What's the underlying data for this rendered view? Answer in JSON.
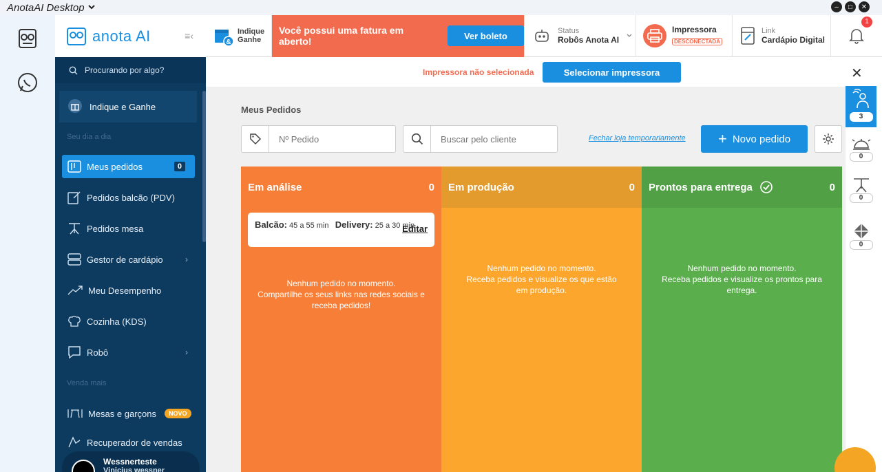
{
  "window": {
    "title": "AnotaAI Desktop"
  },
  "sidebar": {
    "logo": "anota AI",
    "search_placeholder": "Procurando por algo?",
    "invite": "Indique e Ganhe",
    "section_day": "Seu dia a dia",
    "section_sell": "Venda mais",
    "items": [
      {
        "label": "Meus pedidos",
        "count": "0"
      },
      {
        "label": "Pedidos balcão (PDV)"
      },
      {
        "label": "Pedidos mesa"
      },
      {
        "label": "Gestor de cardápio"
      },
      {
        "label": "Meu Desempenho"
      },
      {
        "label": "Cozinha (KDS)"
      },
      {
        "label": "Robô"
      },
      {
        "label": "Mesas e garçons",
        "badge": "NOVO"
      },
      {
        "label": "Recuperador de vendas"
      }
    ],
    "user": {
      "name": "Wessnerteste",
      "sub": "Vinicius wessner"
    }
  },
  "topbar": {
    "invite_line1": "Indique",
    "invite_line2": "Ganhe",
    "alert_text": "Você possui uma fatura em aberto!",
    "alert_button": "Ver boleto",
    "status_small": "Status",
    "status_big": "Robôs Anota AI",
    "printer_big": "Impressora",
    "printer_badge": "DESCONECTADA",
    "link_small": "Link",
    "link_big": "Cardápio Digital",
    "notifications": "1"
  },
  "printer_bar": {
    "message": "Impressora não selecionada",
    "button": "Selecionar impressora"
  },
  "main": {
    "title": "Meus Pedidos",
    "order_number_placeholder": "Nº Pedido",
    "client_search_placeholder": "Buscar pelo cliente",
    "close_store": "Fechar loja temporariamente",
    "new_order": "Novo pedido"
  },
  "columns": [
    {
      "title": "Em análise",
      "count": "0",
      "empty_lines": [
        "Nenhum pedido no momento.",
        "Compartilhe os seus links nas redes sociais e",
        "receba pedidos!"
      ]
    },
    {
      "title": "Em produção",
      "count": "0",
      "empty_lines": [
        "Nenhum pedido no momento.",
        "Receba pedidos e visualize os que estão",
        "em produção."
      ]
    },
    {
      "title": "Prontos para entrega",
      "count": "0",
      "empty_lines": [
        "Nenhum pedido no momento.",
        "Receba pedidos e visualize os prontos para",
        "entrega."
      ]
    }
  ],
  "time_card": {
    "balcao_label": "Balcão:",
    "balcao_value": "45 a 55 min",
    "delivery_label": "Delivery:",
    "delivery_value": "25 a 30 min",
    "edit": "Editar"
  },
  "right_rail": {
    "counts": [
      "3",
      "0",
      "0",
      "0"
    ]
  },
  "colors": {
    "accent": "#1a8fe0",
    "alert": "#f36b4f",
    "analysis": "#f77e36",
    "production": "#fca62e",
    "ready": "#5aae4c",
    "sidebar": "#0d3a5f"
  }
}
